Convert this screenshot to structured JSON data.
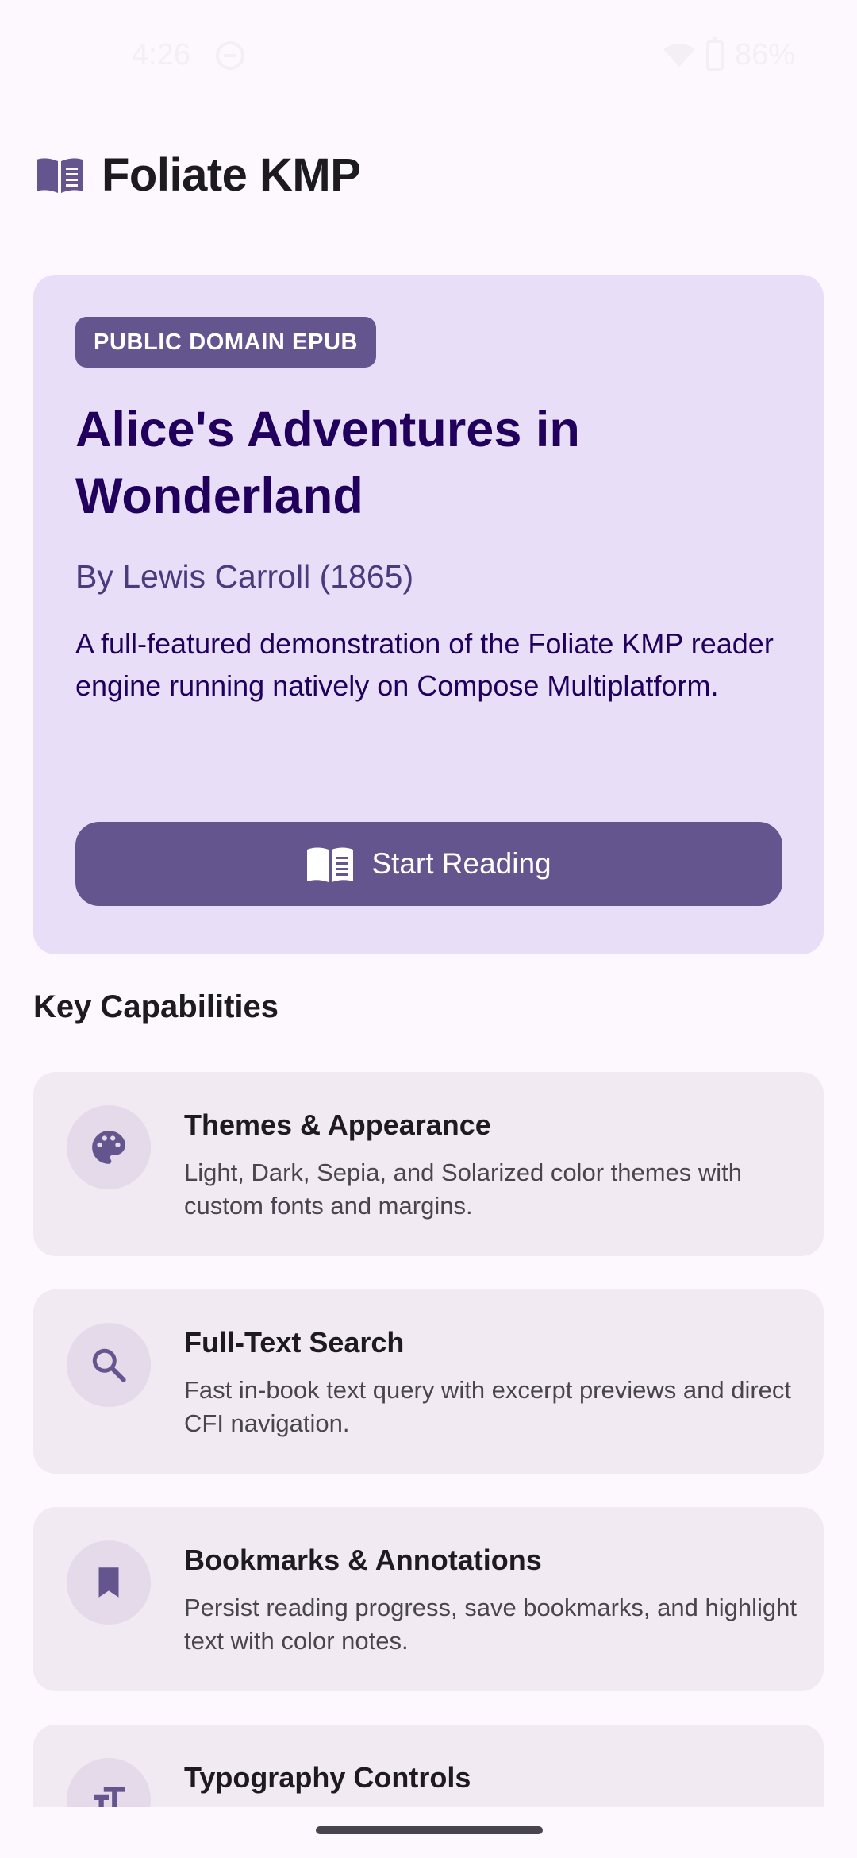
{
  "status_bar": {
    "time": "4:26",
    "battery": "86%"
  },
  "app": {
    "title": "Foliate KMP"
  },
  "hero": {
    "badge": "PUBLIC DOMAIN EPUB",
    "title": "Alice's Adventures in Wonderland",
    "author": "By Lewis Carroll (1865)",
    "description": "A full-featured demonstration of the Foliate KMP reader engine running natively on Compose Multiplatform.",
    "button_label": "Start Reading"
  },
  "capabilities": {
    "heading": "Key Capabilities",
    "items": [
      {
        "icon": "palette-icon",
        "title": "Themes & Appearance",
        "description": "Light, Dark, Sepia, and Solarized color themes with custom fonts and margins."
      },
      {
        "icon": "search-icon",
        "title": "Full-Text Search",
        "description": "Fast in-book text query with excerpt previews and direct CFI navigation."
      },
      {
        "icon": "bookmark-icon",
        "title": "Bookmarks & Annotations",
        "description": "Persist reading progress, save bookmarks, and highlight text with color notes."
      },
      {
        "icon": "text-size-icon",
        "title": "Typography Controls",
        "description": ""
      }
    ]
  },
  "colors": {
    "primary": "#65558F",
    "hero_bg": "#E8DEF8",
    "card_bg": "#F1EAF2",
    "background": "#FDF8FD"
  }
}
